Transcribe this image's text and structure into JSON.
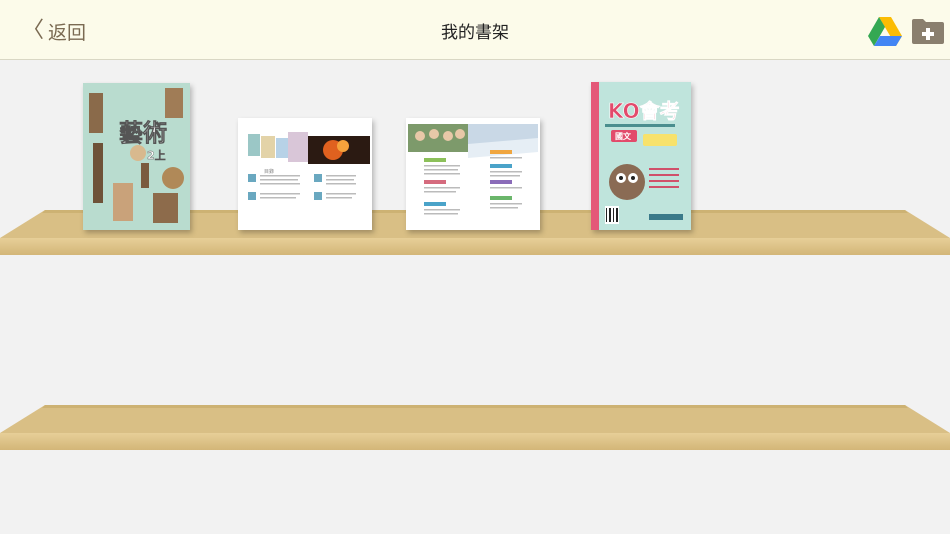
{
  "header": {
    "back_label": "返回",
    "title": "我的書架"
  },
  "icons": {
    "back": "chevron-left-icon",
    "drive": "google-drive-icon",
    "add_folder": "folder-add-icon"
  },
  "books": [
    {
      "cover_text": "藝術",
      "grade_text": "2上",
      "cover_color": "#b9dccf"
    },
    {
      "cover_text": "",
      "cover_color": "#ffffff"
    },
    {
      "cover_text": "",
      "cover_color": "#ffffff"
    },
    {
      "cover_text": "KO會考",
      "subject_text": "國文",
      "cover_color": "#bfe4dc"
    }
  ],
  "colors": {
    "topbar_bg": "#fcfbea",
    "shelf_wood": "#d9bf85",
    "background": "#f2f2f2"
  }
}
